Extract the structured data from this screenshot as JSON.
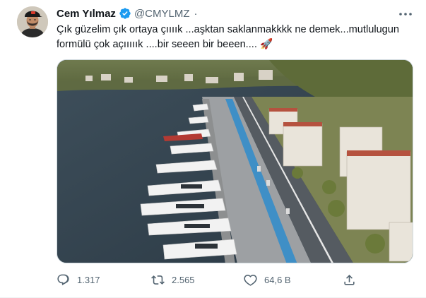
{
  "author": {
    "display_name": "Cem Yılmaz",
    "handle": "@CMYLMZ",
    "verified": true,
    "avatar_icon": "avatar-photo"
  },
  "tweet": {
    "text": "Çık güzelim çık ortaya çıııık ...aşktan saklanmakkkk ne demek...mutlulugun formülü çok açııııık ....bir seeen bir beeen.... 🚀"
  },
  "media": {
    "image_icon": "aerial-marina-photo"
  },
  "actions": {
    "reply": {
      "icon": "reply-icon",
      "count": "1.317"
    },
    "retweet": {
      "icon": "retweet-icon",
      "count": "2.565"
    },
    "like": {
      "icon": "heart-icon",
      "count": "64,6 B"
    },
    "share": {
      "icon": "share-icon"
    }
  },
  "colors": {
    "verified_badge": "#1d9bf0",
    "secondary_text": "#536471",
    "border": "#cfd9de"
  }
}
